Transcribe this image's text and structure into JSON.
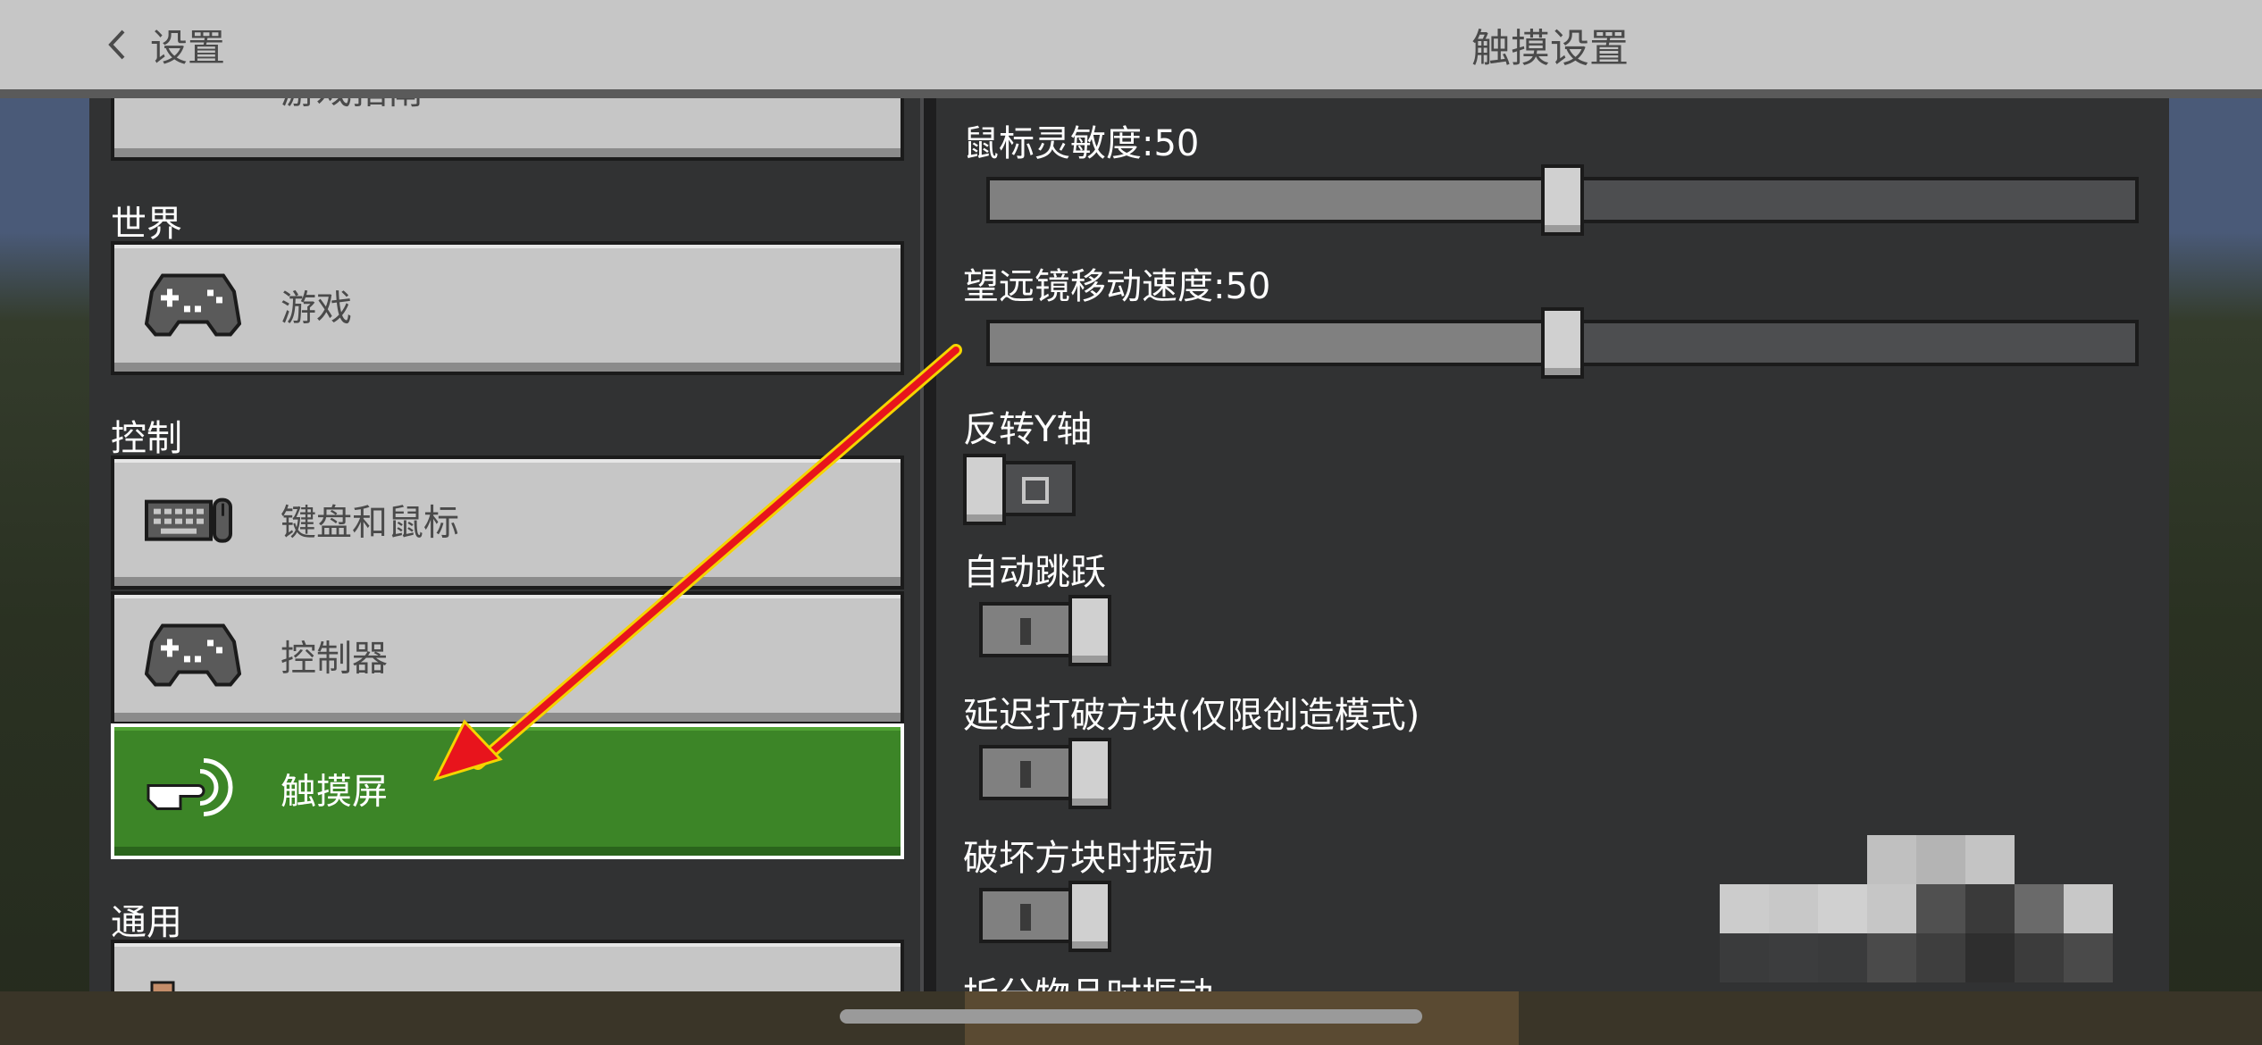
{
  "header": {
    "back_label": "设置",
    "title": "触摸设置"
  },
  "sidebar": {
    "partial_top_label": "游戏指南",
    "sections": [
      {
        "title": "世界",
        "items": [
          {
            "label": "游戏",
            "icon": "gamepad-icon"
          }
        ]
      },
      {
        "title": "控制",
        "items": [
          {
            "label": "键盘和鼠标",
            "icon": "keyboard-mouse-icon"
          },
          {
            "label": "控制器",
            "icon": "controller-icon"
          },
          {
            "label": "触摸屏",
            "icon": "touch-hand-icon",
            "active": true
          }
        ]
      },
      {
        "title": "通用",
        "items": []
      }
    ]
  },
  "settings": {
    "mouse_sensitivity": {
      "label": "鼠标灵敏度:50",
      "value": 50,
      "max": 100
    },
    "spyglass_speed": {
      "label": "望远镜移动速度:50",
      "value": 50,
      "max": 100
    },
    "invert_y": {
      "label": "反转Y轴",
      "state": "off"
    },
    "auto_jump": {
      "label": "自动跳跃",
      "state": "on"
    },
    "delayed_break": {
      "label": "延迟打破方块(仅限创造模式)",
      "state": "on"
    },
    "vibrate_break": {
      "label": "破坏方块时振动",
      "state": "on"
    },
    "partial_next_label": "拆分物品时振动"
  },
  "colors": {
    "header_bg": "#c6c6c6",
    "panel_bg": "#313233",
    "button_bg": "#c6c6c6",
    "active_green": "#3c8527",
    "annotation_arrow": "#e8141c"
  }
}
